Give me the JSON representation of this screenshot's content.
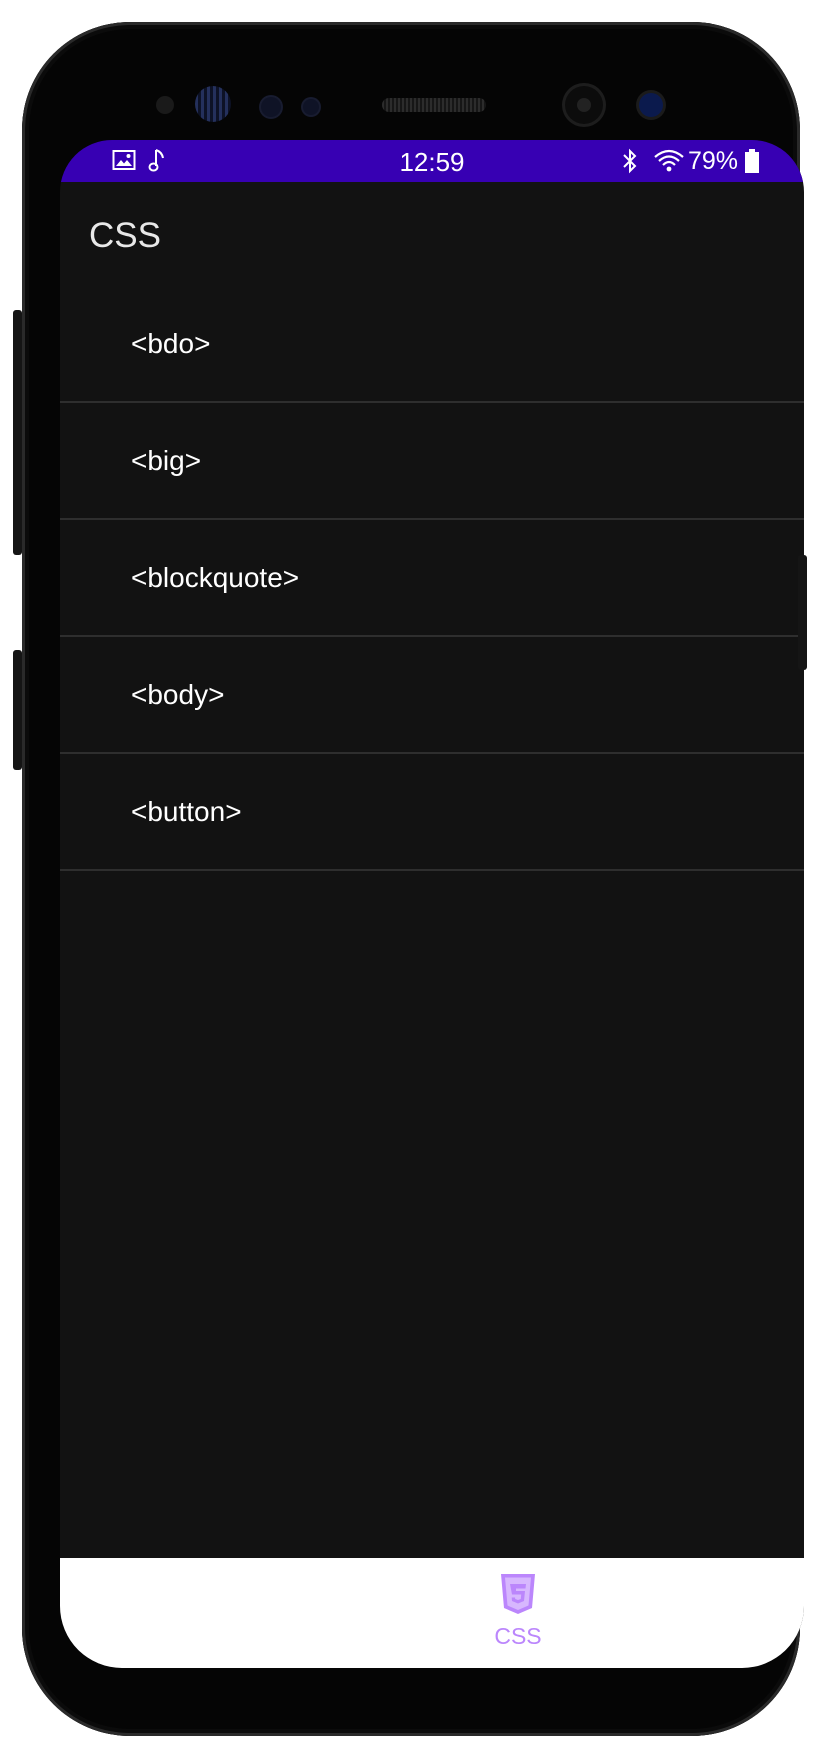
{
  "status_bar": {
    "time": "12:59",
    "battery_percent": "79%",
    "icons": [
      "gallery-icon",
      "music-note-icon",
      "bluetooth-icon",
      "wifi-icon",
      "battery-icon"
    ],
    "background_color": "#3700b3"
  },
  "app_bar": {
    "title": "CSS"
  },
  "list": {
    "items": [
      {
        "label": "<bdo>"
      },
      {
        "label": "<big>"
      },
      {
        "label": "<blockquote>"
      },
      {
        "label": "<body>"
      },
      {
        "label": "<button>"
      }
    ]
  },
  "bottom_nav": {
    "items": [
      {
        "label": "CSS",
        "icon": "css3-shield-icon",
        "active_color": "#bb86fc"
      }
    ]
  },
  "colors": {
    "screen_background": "#121212",
    "divider": "#2e2e2e",
    "accent": "#bb86fc"
  }
}
